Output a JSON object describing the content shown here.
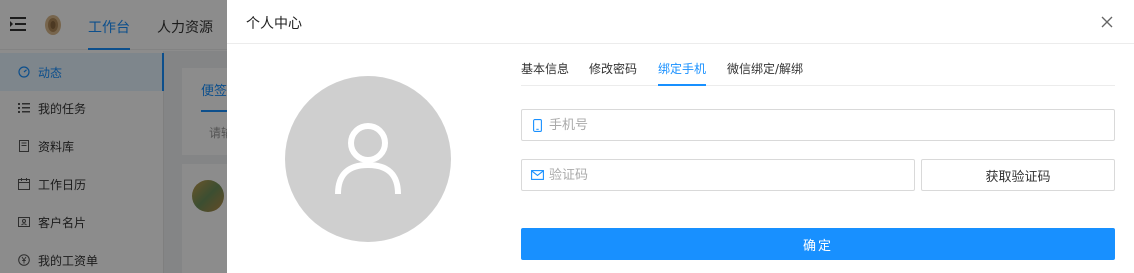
{
  "colors": {
    "accent": "#1890ff",
    "mask": "rgba(0,0,0,0.45)",
    "avatar_bg": "#cfcfcf"
  },
  "app": {
    "top_nav": [
      "工作台",
      "人力资源"
    ],
    "sidebar": [
      {
        "label": "动态",
        "icon": "dashboard-icon",
        "active": true
      },
      {
        "label": "我的任务",
        "icon": "list-icon"
      },
      {
        "label": "资料库",
        "icon": "book-icon"
      },
      {
        "label": "工作日历",
        "icon": "calendar-icon"
      },
      {
        "label": "客户名片",
        "icon": "contact-card-icon"
      },
      {
        "label": "我的工资单",
        "icon": "yen-icon"
      }
    ],
    "content": {
      "card_tab": "便签",
      "card_input_placeholder": "请输"
    }
  },
  "drawer": {
    "title": "个人中心",
    "tabs": [
      {
        "label": "基本信息"
      },
      {
        "label": "修改密码"
      },
      {
        "label": "绑定手机",
        "active": true
      },
      {
        "label": "微信绑定/解绑"
      }
    ],
    "phone": {
      "placeholder": "手机号",
      "value": ""
    },
    "code": {
      "placeholder": "验证码",
      "value": ""
    },
    "get_code_label": "获取验证码",
    "confirm_label": "确定"
  }
}
